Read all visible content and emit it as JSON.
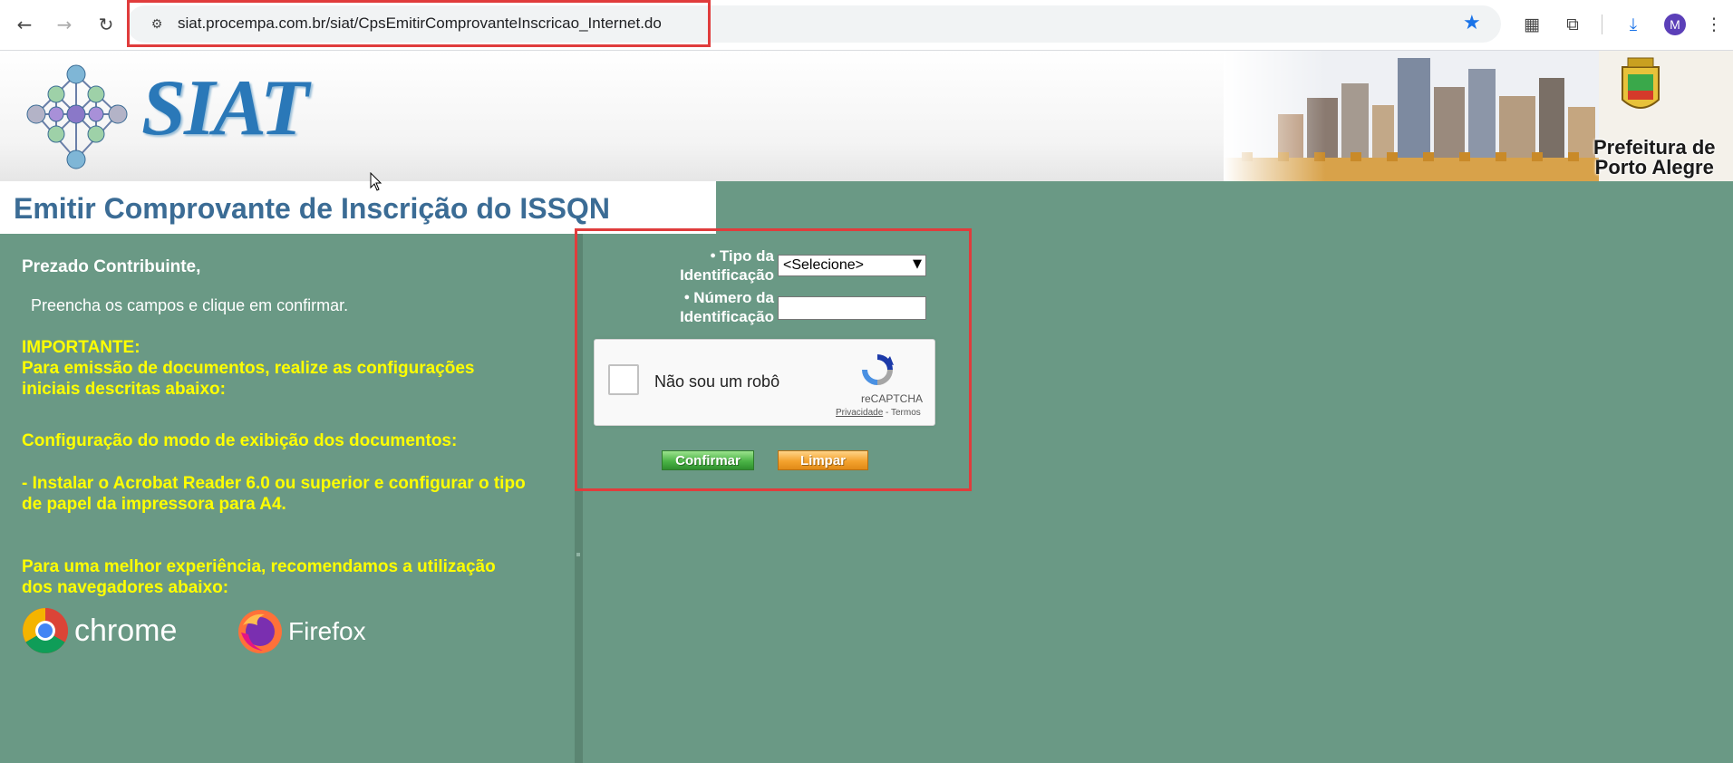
{
  "browser": {
    "url": "siat.procempa.com.br/siat/CpsEmitirComprovanteInscricao_Internet.do",
    "avatar_letter": "M"
  },
  "header": {
    "logo_text": "SIAT",
    "prefeitura_line1": "Prefeitura de",
    "prefeitura_line2": "Porto Alegre"
  },
  "page": {
    "title": "Emitir Comprovante de Inscrição do ISSQN"
  },
  "left": {
    "greeting": "Prezado Contribuinte,",
    "instruction": "Preencha os campos e clique em confirmar.",
    "important_title": "IMPORTANTE:",
    "important_text": "Para emissão de documentos, realize as configurações iniciais descritas abaixo:",
    "config_title": "Configuração do modo de exibição dos documentos:",
    "config_text": "- Instalar o Acrobat Reader 6.0 ou superior e configurar o tipo de papel da impressora para A4.",
    "browsers_text": "Para uma melhor experiência, recomendamos a utilização dos navegadores abaixo:",
    "chrome_label": "chrome",
    "firefox_label": "Firefox"
  },
  "form": {
    "tipo_label_1": "Tipo da",
    "tipo_label_2": "Identificação",
    "tipo_selected": "<Selecione>",
    "numero_label_1": "Número da",
    "numero_label_2": "Identificação",
    "numero_value": "",
    "captcha_label": "Não sou um robô",
    "captcha_brand": "reCAPTCHA",
    "captcha_privacy": "Privacidade",
    "captcha_sep": " - ",
    "captcha_terms": "Termos",
    "confirm_label": "Confirmar",
    "clear_label": "Limpar"
  },
  "colors": {
    "page_green": "#6a9985",
    "title_blue": "#3b6c95",
    "highlight_red": "#e03c3c",
    "notice_yellow": "#ffff00"
  }
}
